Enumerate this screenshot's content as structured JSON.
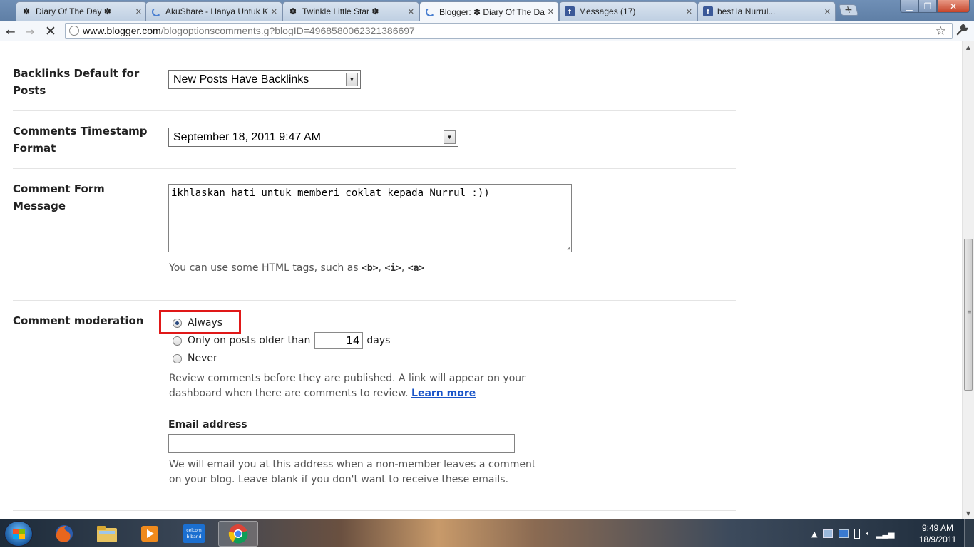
{
  "browser": {
    "tabs": [
      {
        "title": "Diary Of The Day ✽",
        "icon": "flower-icon",
        "active": false
      },
      {
        "title": "AkuShare - Hanya Untuk Ka",
        "icon": "loading-icon",
        "active": false
      },
      {
        "title": "Twinkle Little Star ✽",
        "icon": "flower-icon",
        "active": false
      },
      {
        "title": "Blogger: ✽ Diary Of The Da",
        "icon": "loading-icon",
        "active": true
      },
      {
        "title": "Messages (17)",
        "icon": "facebook-icon",
        "active": false
      },
      {
        "title": "best la Nurrul...",
        "icon": "facebook-icon",
        "active": false
      }
    ],
    "url_host": "www.blogger.com",
    "url_path": "/blogoptionscomments.g?blogID=4968580062321386697"
  },
  "settings": {
    "backlinks": {
      "label": "Backlinks Default for Posts",
      "selected": "New Posts Have Backlinks"
    },
    "timestamp": {
      "label": "Comments Timestamp Format",
      "selected": "September 18, 2011 9:47 AM"
    },
    "form_message": {
      "label": "Comment Form Message",
      "value": "ikhlaskan hati untuk memberi coklat kepada Nurrul :))",
      "help_prefix": "You can use some HTML tags, such as ",
      "tag_b": "<b>",
      "tag_i": "<i>",
      "tag_a": "<a>",
      "sep": ", "
    },
    "moderation": {
      "label": "Comment moderation",
      "options": [
        {
          "label": "Always",
          "checked": true
        },
        {
          "label": "Only on posts older than",
          "checked": false
        },
        {
          "label": "Never",
          "checked": false
        }
      ],
      "days_value": "14",
      "days_suffix": "days",
      "help_line1": "Review comments before they are published. A link will appear on your",
      "help_line2": "dashboard when there are comments to review.",
      "learn_more": "Learn more",
      "highlight_color": "#e01818"
    },
    "email": {
      "label": "Email address",
      "value": "",
      "help_line1": "We will email you at this address when a non-member leaves a comment",
      "help_line2": "on your blog. Leave blank if you don't want to receive these emails."
    }
  },
  "taskbar": {
    "apps": [
      {
        "name": "firefox-app"
      },
      {
        "name": "file-explorer-app"
      },
      {
        "name": "media-player-app"
      },
      {
        "name": "celcom-broadband-app"
      },
      {
        "name": "chrome-app"
      }
    ],
    "celcom_line1": "celcom",
    "celcom_line2": "b.band",
    "time": "9:49 AM",
    "date": "18/9/2011"
  }
}
